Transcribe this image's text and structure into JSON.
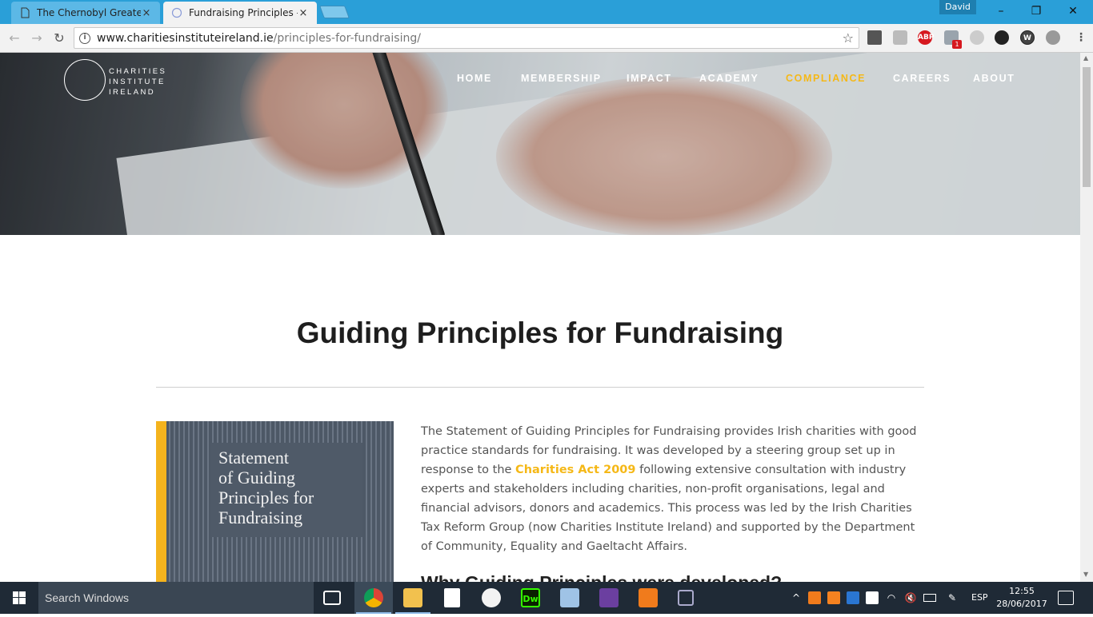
{
  "browser": {
    "tabs": [
      {
        "title": "The Chernobyl Greater C",
        "close": "×"
      },
      {
        "title": "Fundraising Principles —",
        "close": "×"
      }
    ],
    "profile_name": "David",
    "window_controls": {
      "minimize": "–",
      "restore": "❐",
      "close": "✕"
    },
    "url_host": "www.charitiesinstituteireland.ie",
    "url_path": "/principles-for-fundraising/",
    "extensions": [
      "mail-icon",
      "cube-icon",
      "adblock-plus-icon",
      "puzzle-icon",
      "gear-light-icon",
      "gear-dark-icon",
      "w-icon",
      "bolt-icon"
    ],
    "abp_label": "ABP",
    "ext_badge": "1",
    "w_label": "W"
  },
  "site": {
    "logo_lines": [
      "CHARITIES",
      "INSTITUTE",
      "IRELAND"
    ],
    "nav": [
      {
        "label": "HOME",
        "active": false
      },
      {
        "label": "MEMBERSHIP",
        "active": false
      },
      {
        "label": "IMPACT",
        "active": false
      },
      {
        "label": "ACADEMY",
        "active": false
      },
      {
        "label": "COMPLIANCE",
        "active": true
      },
      {
        "label": "CAREERS",
        "active": false
      },
      {
        "label": "ABOUT",
        "active": false
      }
    ],
    "accent_color": "#f5b817"
  },
  "content": {
    "title": "Guiding Principles for Fundraising",
    "book_cover_title": [
      "Statement",
      "of Guiding",
      "Principles for",
      "Fundraising"
    ],
    "paragraph_before_link": "The Statement of Guiding Principles for Fundraising provides Irish charities with good practice standards for fundraising. It was developed by a steering group set up in response to the ",
    "paragraph_link": "Charities Act 2009",
    "paragraph_after_link": " following extensive consultation with industry experts and stakeholders including charities, non-profit organisations, legal and financial advisors, donors and academics. This process was led by the Irish Charities Tax Reform Group (now Charities Institute Ireland) and supported by the Department of Community, Equality and Gaeltacht Affairs.",
    "subheading": "Why Guiding Principles were developed?"
  },
  "taskbar": {
    "search_placeholder": "Search Windows",
    "dw_label": "Dw",
    "language": "ESP",
    "time": "12:55",
    "date": "28/06/2017"
  }
}
